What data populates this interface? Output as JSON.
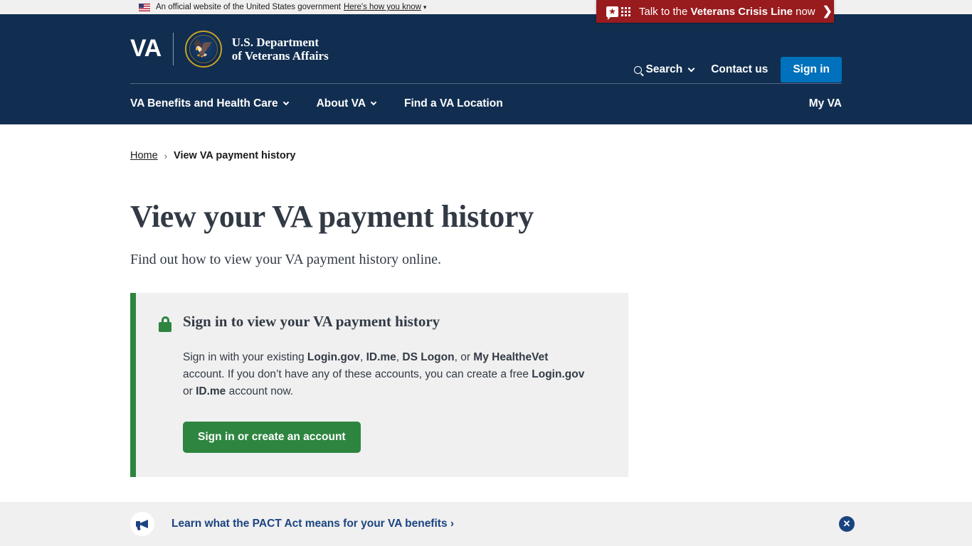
{
  "gov_banner": {
    "text": "An official website of the United States government",
    "link_label": "Here's how you know",
    "flag_icon": "us-flag-icon",
    "chevron_icon": "chevron-down-icon"
  },
  "crisis_banner": {
    "prefix": "Talk to the ",
    "emphasis": "Veterans Crisis Line",
    "suffix": " now",
    "arrow_icon": "chevron-right-icon",
    "icon": "crisis-chat-icon",
    "background_color": "#981b1e"
  },
  "header": {
    "logo_mark": "VA",
    "seal_icon": "va-seal-icon",
    "department_line1": "U.S. Department",
    "department_line2": "of Veterans Affairs",
    "search_label": "Search",
    "search_icon": "search-icon",
    "search_chevron": "chevron-down-icon",
    "contact_label": "Contact us",
    "signin_label": "Sign in",
    "signin_color": "#0071bc",
    "background_color": "#112e51"
  },
  "nav": {
    "items": [
      {
        "label": "VA Benefits and Health Care",
        "has_chevron": true
      },
      {
        "label": "About VA",
        "has_chevron": true
      },
      {
        "label": "Find a VA Location",
        "has_chevron": false
      }
    ],
    "my_va_label": "My VA"
  },
  "breadcrumb": {
    "home_label": "Home",
    "separator": "›",
    "current_label": "View VA payment history"
  },
  "page": {
    "title": "View your VA payment history",
    "subtitle": "Find out how to view your VA payment history online."
  },
  "alert": {
    "lock_icon": "lock-icon",
    "border_color": "#2e8540",
    "background_color": "#f0f0f0",
    "title": "Sign in to view your VA payment history",
    "body_part1": "Sign in with your existing ",
    "body_b1": "Login.gov",
    "body_part2": ", ",
    "body_b2": "ID.me",
    "body_part3": ", ",
    "body_b3": "DS Logon",
    "body_part4": ", or ",
    "body_b4": "My HealtheVet",
    "body_part5": " account. If you don’t have any of these accounts, you can create a free ",
    "body_b5": "Login.gov",
    "body_part6": " or ",
    "body_b6": "ID.me",
    "body_part7": " account now.",
    "button_label": "Sign in or create an account",
    "button_color": "#2e8540"
  },
  "pact_banner": {
    "icon": "megaphone-icon",
    "link_label": "Learn what the PACT Act means for your VA benefits ›",
    "close_icon": "close-icon",
    "link_color": "#1a4480",
    "background_color": "#f0f0f0"
  }
}
